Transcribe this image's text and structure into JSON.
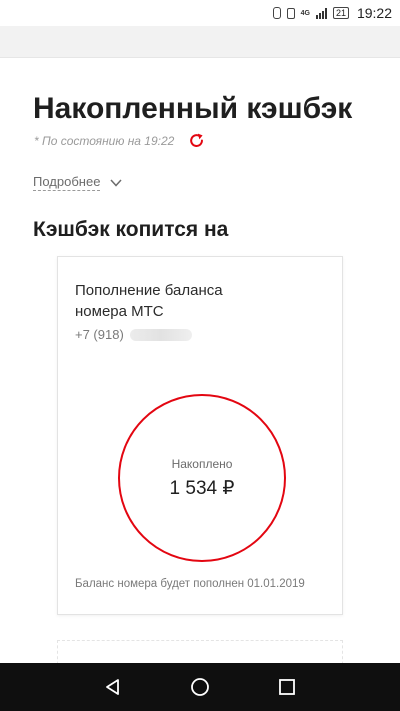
{
  "status_bar": {
    "network": "4G",
    "battery": "21",
    "time": "19:22"
  },
  "header": {
    "title": "Накопленный кэшбэк",
    "status_text": "* По состоянию на 19:22"
  },
  "more": {
    "label": "Подробнее"
  },
  "section": {
    "title": "Кэшбэк копится на"
  },
  "card": {
    "title": "Пополнение баланса номера МТС",
    "phone_prefix": "+7 (918)",
    "accumulated_label": "Накоплено",
    "amount": "1 534 ₽",
    "note": "Баланс номера будет пополнен 01.01.2019"
  },
  "colors": {
    "accent": "#e30611",
    "nav_bar": "#0f0f0f"
  },
  "icons": {
    "refresh": "refresh-icon",
    "more": "chevron-down-icon",
    "nav_back": "back-triangle-icon",
    "nav_home": "home-circle-icon",
    "nav_recent": "recents-square-icon"
  }
}
